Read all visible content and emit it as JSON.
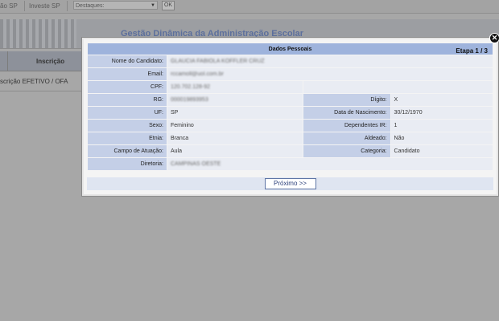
{
  "topbar": {
    "link1": "ão SP",
    "link2": "Investe SP",
    "destaques_select": "Destaques:",
    "ok_button": "OK"
  },
  "banner": {
    "title": "Gestão Dinâmica da Administração Escolar"
  },
  "bg_table": {
    "header_inscricao": "Inscrição",
    "row1": "scrição EFETIVO / OFA"
  },
  "modal": {
    "title": "Dados Pessoais",
    "etapa": "Etapa 1 / 3",
    "fields": {
      "nome_label": "Nome do Candidato:",
      "nome_value": "GLAUCIA FABIOLA KOFFLER CRUZ",
      "email_label": "Email:",
      "email_value": "rccamoll@uol.com.br",
      "cpf_label": "CPF:",
      "cpf_value": "120.702.128-92",
      "rg_label": "RG:",
      "rg_value": "000019893953",
      "digito_label": "Dígito:",
      "digito_value": "X",
      "uf_label": "UF:",
      "uf_value": "SP",
      "nascimento_label": "Data de Nascimento:",
      "nascimento_value": "30/12/1970",
      "sexo_label": "Sexo:",
      "sexo_value": "Feminino",
      "dependentes_label": "Dependentes IR:",
      "dependentes_value": "1",
      "etnia_label": "Etnia:",
      "etnia_value": "Branca",
      "aldeado_label": "Aldeado:",
      "aldeado_value": "Não",
      "campo_label": "Campo de Atuação:",
      "campo_value": "Aula",
      "categoria_label": "Categoria:",
      "categoria_value": "Candidato",
      "diretoria_label": "Diretoria:",
      "diretoria_value": "CAMPINAS OESTE"
    },
    "next_button": "Próximo >>"
  }
}
